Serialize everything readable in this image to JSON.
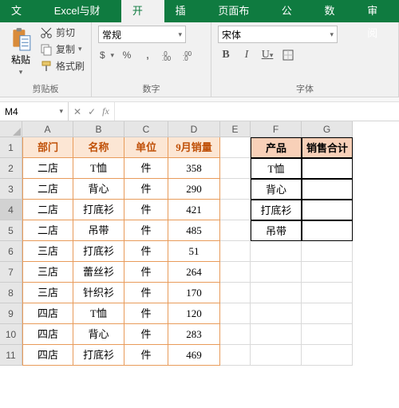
{
  "tabs": [
    "文件",
    "Excel与财务",
    "开始",
    "插入",
    "页面布局",
    "公式",
    "数据",
    "审阅"
  ],
  "active_tab": 2,
  "ribbon": {
    "clipboard": {
      "label": "剪贴板",
      "paste": "粘贴",
      "cut": "剪切",
      "copy": "复制",
      "format_painter": "格式刷"
    },
    "number": {
      "label": "数字",
      "format": "常规"
    },
    "font": {
      "label": "字体",
      "name": "宋体"
    }
  },
  "namebox": "M4",
  "formula": "",
  "cols": [
    "A",
    "B",
    "C",
    "D",
    "E",
    "F",
    "G"
  ],
  "left_header": [
    "部门",
    "名称",
    "单位",
    "9月销量"
  ],
  "left_rows": [
    [
      "二店",
      "T恤",
      "件",
      "358"
    ],
    [
      "二店",
      "背心",
      "件",
      "290"
    ],
    [
      "二店",
      "打底衫",
      "件",
      "421"
    ],
    [
      "二店",
      "吊带",
      "件",
      "485"
    ],
    [
      "三店",
      "打底衫",
      "件",
      "51"
    ],
    [
      "三店",
      "蕾丝衫",
      "件",
      "264"
    ],
    [
      "三店",
      "针织衫",
      "件",
      "170"
    ],
    [
      "四店",
      "T恤",
      "件",
      "120"
    ],
    [
      "四店",
      "背心",
      "件",
      "283"
    ],
    [
      "四店",
      "打底衫",
      "件",
      "469"
    ]
  ],
  "right_header": [
    "产品",
    "销售合计"
  ],
  "right_rows": [
    [
      "T恤",
      ""
    ],
    [
      "背心",
      ""
    ],
    [
      "打底衫",
      ""
    ],
    [
      "吊带",
      ""
    ]
  ]
}
